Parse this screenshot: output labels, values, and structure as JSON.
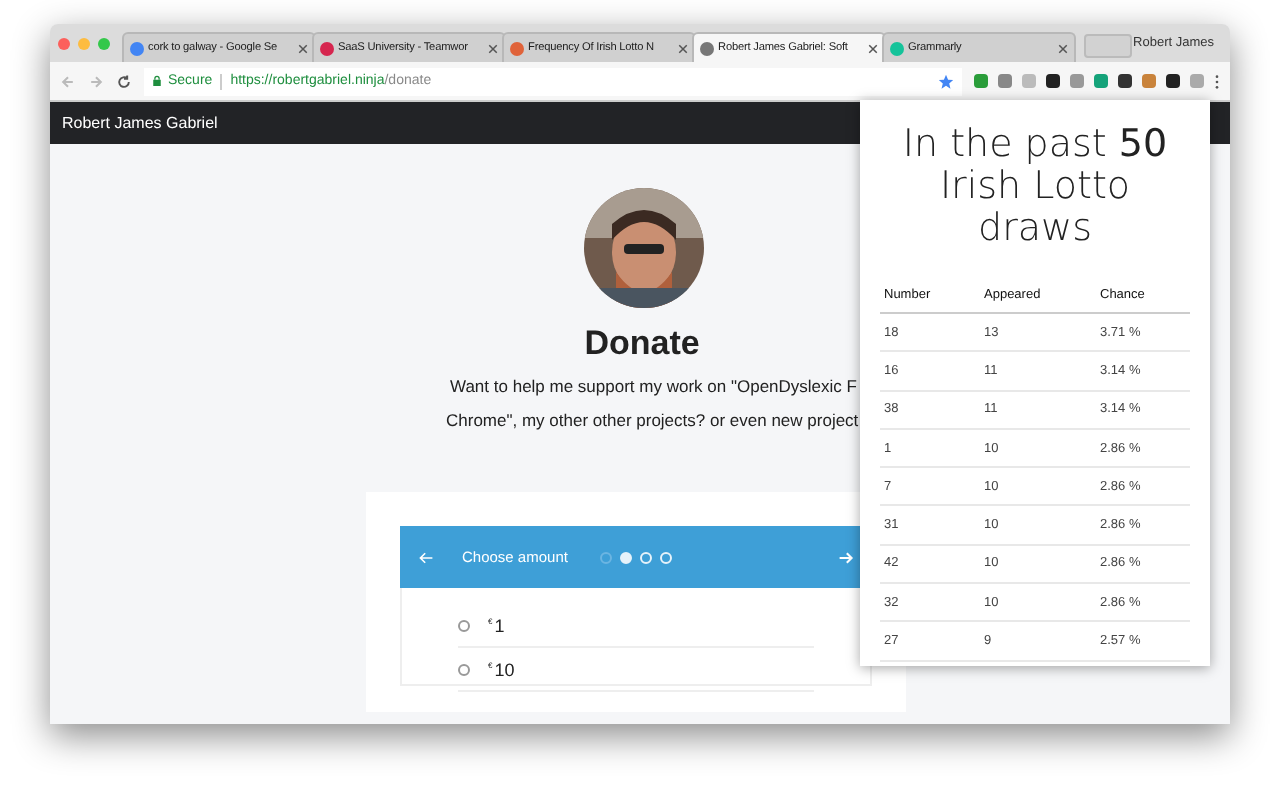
{
  "tabs": [
    {
      "title": "cork to galway - Google Se",
      "selected": false,
      "color": "#4285f4"
    },
    {
      "title": "SaaS University - Teamwor",
      "selected": false,
      "color": "#d6264f"
    },
    {
      "title": "Frequency Of Irish Lotto N",
      "selected": false,
      "color": "#e0633a"
    },
    {
      "title": "Robert James Gabriel: Soft",
      "selected": true,
      "color": "#777777"
    },
    {
      "title": "Grammarly",
      "selected": false,
      "color": "#15c39a"
    }
  ],
  "profile": "Robert James",
  "address": {
    "secure": "Secure",
    "host": "https://robertgabriel.ninja",
    "path": "/donate"
  },
  "site": {
    "brand": "Robert James Gabriel",
    "heading": "Donate",
    "intro": [
      "Want to help me support my work on \"OpenDyslexic F",
      "Chrome\", my other other projects? or even new project"
    ]
  },
  "wizard": {
    "title": "Choose amount",
    "steps": [
      {
        "selected": false,
        "faint": true
      },
      {
        "selected": true,
        "faint": false
      },
      {
        "selected": false,
        "faint": false
      },
      {
        "selected": false,
        "faint": false
      }
    ],
    "options": [
      {
        "currency": "€",
        "amount": "1",
        "selected": false
      },
      {
        "currency": "€",
        "amount": "10",
        "selected": false
      }
    ]
  },
  "popup": {
    "title": "In the past **50** Irish Lotto draws",
    "columns": [
      "Number",
      "Appeared",
      "Chance"
    ],
    "rows": [
      [
        "18",
        "13",
        "3.71 %"
      ],
      [
        "16",
        "11",
        "3.14 %"
      ],
      [
        "38",
        "11",
        "3.14 %"
      ],
      [
        "1",
        "10",
        "2.86 %"
      ],
      [
        "7",
        "10",
        "2.86 %"
      ],
      [
        "31",
        "10",
        "2.86 %"
      ],
      [
        "42",
        "10",
        "2.86 %"
      ],
      [
        "32",
        "10",
        "2.86 %"
      ],
      [
        "27",
        "9",
        "2.57 %"
      ]
    ]
  }
}
